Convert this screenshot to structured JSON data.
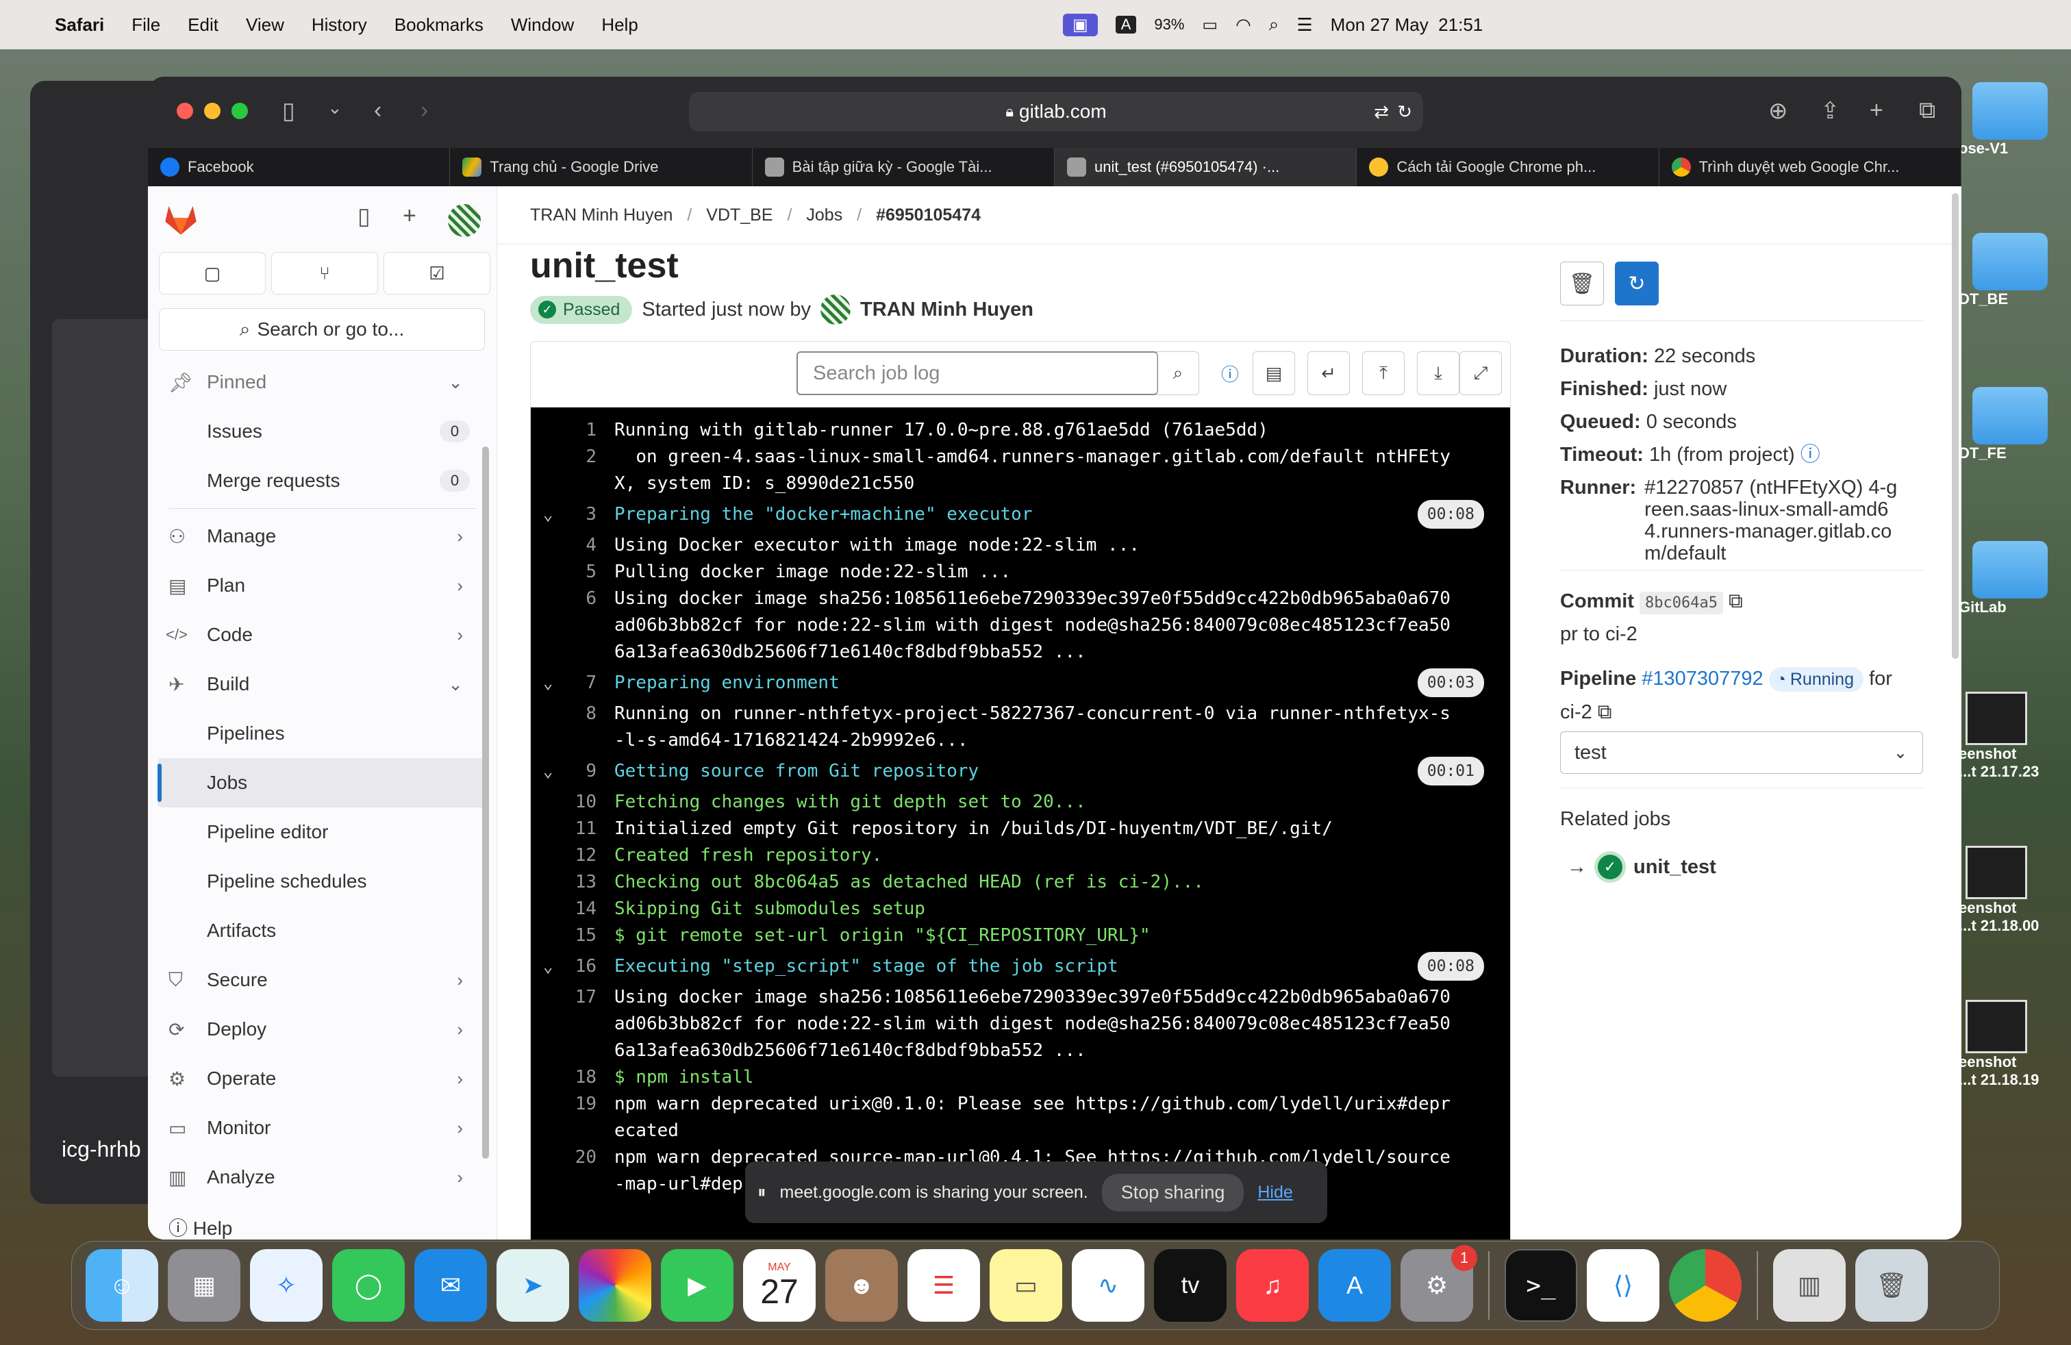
{
  "menubar": {
    "app": "Safari",
    "items": [
      "File",
      "Edit",
      "View",
      "History",
      "Bookmarks",
      "Window",
      "Help"
    ],
    "battery": "93%",
    "datetime": "Mon 27 May  21:51",
    "input_label": "A"
  },
  "background": {
    "window_label": "icg-hrhb",
    "desktop_items": [
      {
        "label": "ose-V1"
      },
      {
        "label": "DT_BE"
      },
      {
        "label": "DT_FE"
      },
      {
        "label": "GitLab"
      },
      {
        "label": "eenshot\n...t 21.17.23"
      },
      {
        "label": "eenshot\n...t 21.18.00"
      },
      {
        "label": "eenshot\n...t 21.18.19"
      }
    ]
  },
  "browser": {
    "url": "gitlab.com",
    "tabs": [
      {
        "label": "Facebook",
        "color": "#1877f2"
      },
      {
        "label": "Trang chủ - Google Drive",
        "color": "#f4b400"
      },
      {
        "label": "Bài tập giữa kỳ - Google Tài...",
        "color": "#9e9e9e"
      },
      {
        "label": "unit_test (#6950105474) ·...",
        "color": "#9e9e9e"
      },
      {
        "label": "Cách tải Google Chrome ph...",
        "color": "#fbc02d"
      },
      {
        "label": "Trình duyệt web Google Chr...",
        "color": "#4285f4"
      }
    ]
  },
  "sidebar": {
    "search": "Search or go to...",
    "pinned": "Pinned",
    "pinned_items": [
      {
        "label": "Issues",
        "count": "0"
      },
      {
        "label": "Merge requests",
        "count": "0"
      }
    ],
    "groups": [
      {
        "label": "Manage",
        "icon": "⚇"
      },
      {
        "label": "Plan",
        "icon": "▤"
      },
      {
        "label": "Code",
        "icon": "</>"
      },
      {
        "label": "Build",
        "icon": "✈"
      }
    ],
    "build_items": [
      "Pipelines",
      "Jobs",
      "Pipeline editor",
      "Pipeline schedules",
      "Artifacts"
    ],
    "lower_groups": [
      {
        "label": "Secure",
        "icon": "⛉"
      },
      {
        "label": "Deploy",
        "icon": "⟳"
      },
      {
        "label": "Operate",
        "icon": "⚙"
      },
      {
        "label": "Monitor",
        "icon": "▭"
      },
      {
        "label": "Analyze",
        "icon": "▥"
      }
    ],
    "help": "Help"
  },
  "breadcrumb": [
    "TRAN Minh Huyen",
    "VDT_BE",
    "Jobs",
    "#6950105474"
  ],
  "job": {
    "title": "unit_test",
    "status": "Passed",
    "started": "Started just now by",
    "user": "TRAN Minh Huyen",
    "search_placeholder": "Search job log"
  },
  "log": [
    {
      "n": "1",
      "t": "Running with gitlab-runner 17.0.0~pre.88.g761ae5dd (761ae5dd)",
      "k": ""
    },
    {
      "n": "2",
      "t": "  on green-4.saas-linux-small-amd64.runners-manager.gitlab.com/default ntHFEtyX, system ID: s_8990de21c550",
      "k": ""
    },
    {
      "n": "3",
      "t": "Preparing the \"docker+machine\" executor",
      "k": "sec",
      "d": "00:08"
    },
    {
      "n": "4",
      "t": "Using Docker executor with image node:22-slim ...",
      "k": ""
    },
    {
      "n": "5",
      "t": "Pulling docker image node:22-slim ...",
      "k": ""
    },
    {
      "n": "6",
      "t": "Using docker image sha256:1085611e6ebe7290339ec397e0f55dd9cc422b0db965aba0a670ad06b3bb82cf for node:22-slim with digest node@sha256:840079c08ec485123cf7ea506a13afea630db25606f71e6140cf8dbdf9bba552 ...",
      "k": ""
    },
    {
      "n": "7",
      "t": "Preparing environment",
      "k": "sec",
      "d": "00:03"
    },
    {
      "n": "8",
      "t": "Running on runner-nthfetyx-project-58227367-concurrent-0 via runner-nthfetyx-s-l-s-amd64-1716821424-2b9992e6...",
      "k": ""
    },
    {
      "n": "9",
      "t": "Getting source from Git repository",
      "k": "sec",
      "d": "00:01"
    },
    {
      "n": "10",
      "t": "Fetching changes with git depth set to 20...",
      "k": "grn"
    },
    {
      "n": "11",
      "t": "Initialized empty Git repository in /builds/DI-huyentm/VDT_BE/.git/",
      "k": ""
    },
    {
      "n": "12",
      "t": "Created fresh repository.",
      "k": "grn"
    },
    {
      "n": "13",
      "t": "Checking out 8bc064a5 as detached HEAD (ref is ci-2)...",
      "k": "grn"
    },
    {
      "n": "14",
      "t": "Skipping Git submodules setup",
      "k": "grn"
    },
    {
      "n": "15",
      "t": "$ git remote set-url origin \"${CI_REPOSITORY_URL}\"",
      "k": "grn"
    },
    {
      "n": "16",
      "t": "Executing \"step_script\" stage of the job script",
      "k": "sec",
      "d": "00:08"
    },
    {
      "n": "17",
      "t": "Using docker image sha256:1085611e6ebe7290339ec397e0f55dd9cc422b0db965aba0a670ad06b3bb82cf for node:22-slim with digest node@sha256:840079c08ec485123cf7ea506a13afea630db25606f71e6140cf8dbdf9bba552 ...",
      "k": ""
    },
    {
      "n": "18",
      "t": "$ npm install",
      "k": "grn"
    },
    {
      "n": "19",
      "t": "npm warn deprecated urix@0.1.0: Please see https://github.com/lydell/urix#deprecated",
      "k": ""
    },
    {
      "n": "20",
      "t": "npm warn deprecated source-map-url@0.4.1: See https://github.com/lydell/source-map-url#deprecated",
      "k": ""
    }
  ],
  "share_bar": {
    "text": "meet.google.com is sharing your screen.",
    "stop": "Stop sharing",
    "hide": "Hide"
  },
  "details": {
    "duration_k": "Duration:",
    "duration_v": "22 seconds",
    "finished_k": "Finished:",
    "finished_v": "just now",
    "queued_k": "Queued:",
    "queued_v": "0 seconds",
    "timeout_k": "Timeout:",
    "timeout_v": "1h (from project)",
    "runner_k": "Runner:",
    "runner_v": "#12270857 (ntHFEtyXQ) 4-green.saas-linux-small-amd64.runners-manager.gitlab.com/default",
    "commit_k": "Commit",
    "commit_v": "8bc064a5",
    "commit_msg": "pr to ci-2",
    "pipeline_k": "Pipeline",
    "pipeline_v": "#1307307792",
    "pipeline_status": "Running",
    "for": "for",
    "branch": "ci-2",
    "stage": "test",
    "related": "Related jobs",
    "related_job": "unit_test"
  },
  "dock": {
    "calendar_month": "MAY",
    "calendar_day": "27",
    "tv_label": "tv",
    "settings_badge": "1"
  },
  "colors": {
    "accent": "#1f75cb",
    "success": "#108548",
    "log_bg": "#000000",
    "section": "#5ed4e2",
    "green": "#7ee36b"
  }
}
